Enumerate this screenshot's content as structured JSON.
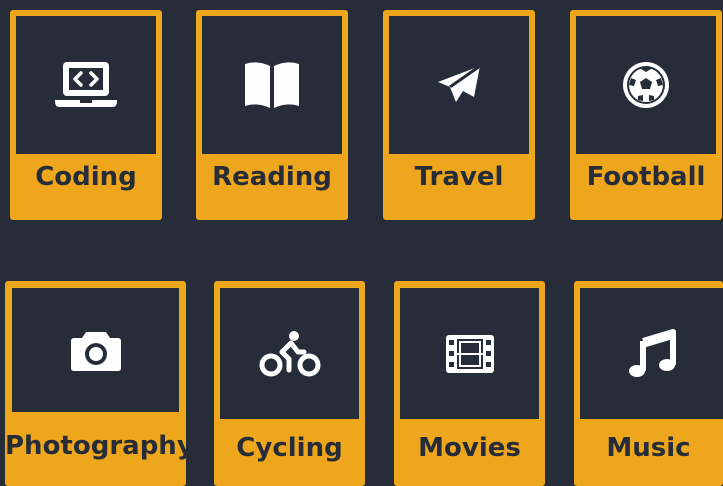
{
  "colors": {
    "background": "#262d38",
    "accent": "#eea61c",
    "icon": "#ffffff",
    "label": "#262d38"
  },
  "hobbies": [
    {
      "label": "Coding",
      "icon": "laptop-code-icon"
    },
    {
      "label": "Reading",
      "icon": "book-open-icon"
    },
    {
      "label": "Travel",
      "icon": "paper-plane-icon"
    },
    {
      "label": "Football",
      "icon": "soccer-ball-icon"
    },
    {
      "label": "Photography",
      "icon": "camera-icon"
    },
    {
      "label": "Cycling",
      "icon": "cyclist-icon"
    },
    {
      "label": "Movies",
      "icon": "film-icon"
    },
    {
      "label": "Music",
      "icon": "music-note-icon"
    }
  ]
}
